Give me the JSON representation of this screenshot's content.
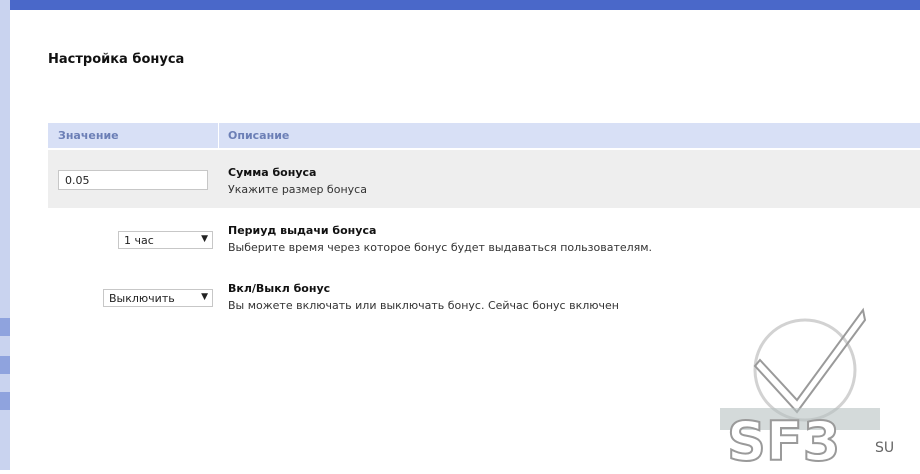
{
  "page": {
    "title": "Настройка бонуса"
  },
  "table": {
    "header": {
      "value": "Значение",
      "description": "Описание"
    },
    "rows": [
      {
        "title": "Сумма бонуса",
        "description": "Укажите размер бонуса",
        "control": "input",
        "value": "0.05"
      },
      {
        "title": "Периуд выдачи бонуса",
        "description": "Выберите время через которое бонус будет выдаваться пользователям.",
        "control": "select",
        "value": "1 час"
      },
      {
        "title": "Вкл/Выкл бонус",
        "description": "Вы можете включать или выключать бонус. Сейчас бонус включен",
        "control": "select",
        "value": "Выключить"
      }
    ]
  },
  "watermark": {
    "text": "SF3",
    "suffix": "SU"
  },
  "colors": {
    "accent": "#4a68c9",
    "header_bg": "#d8e0f6",
    "header_text": "#6c7fb6",
    "row_bg": "#eeeeee"
  }
}
